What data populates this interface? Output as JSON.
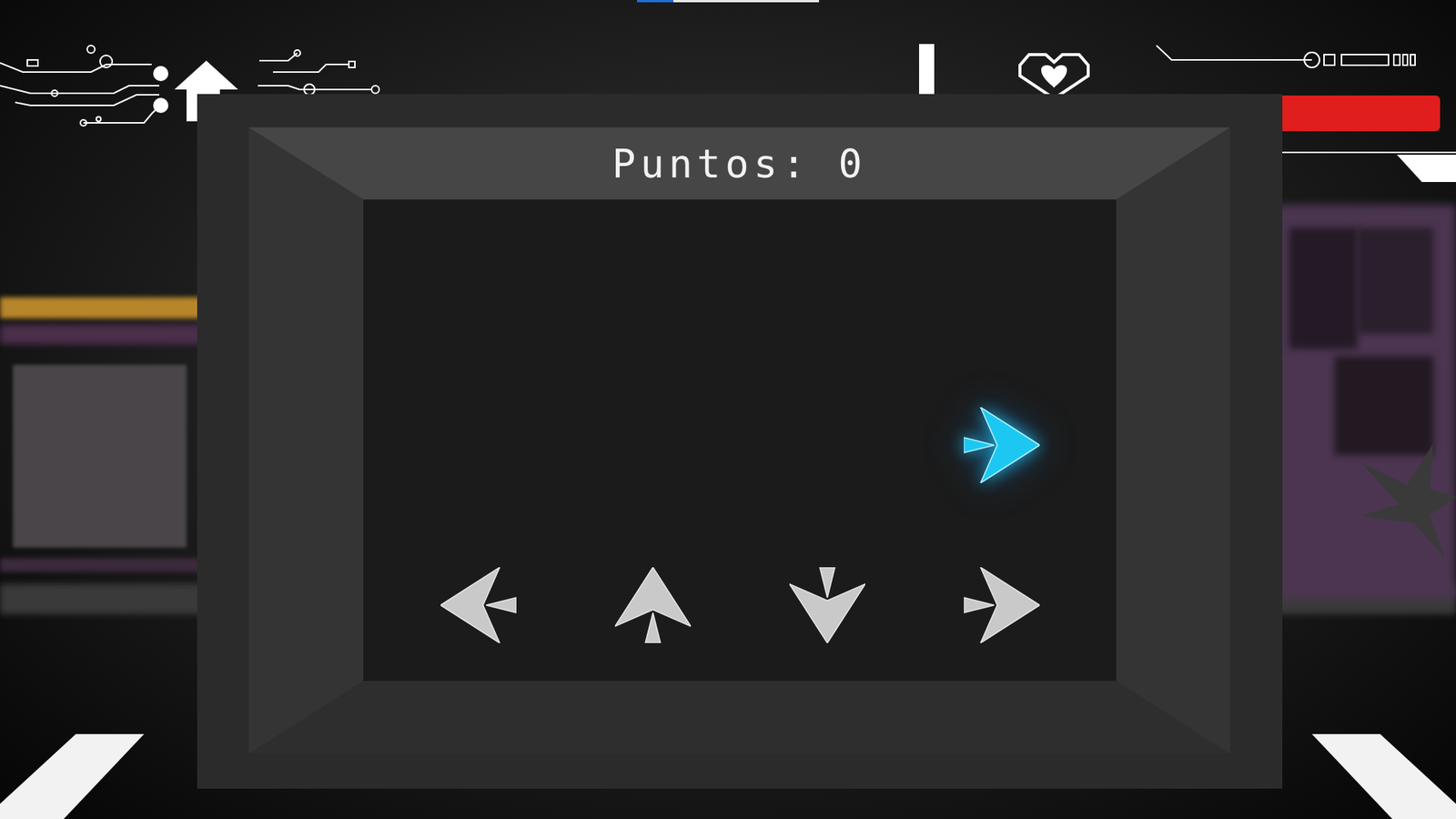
{
  "hud": {
    "health": {
      "level": 1
    },
    "track": {
      "level": 0.2
    }
  },
  "minigame": {
    "score": "Puntos: 0",
    "lanes": [
      {
        "kind": "left"
      },
      {
        "kind": "up"
      },
      {
        "kind": "down"
      },
      {
        "kind": "right"
      }
    ],
    "notes": [
      {
        "kind": "right"
      }
    ]
  }
}
